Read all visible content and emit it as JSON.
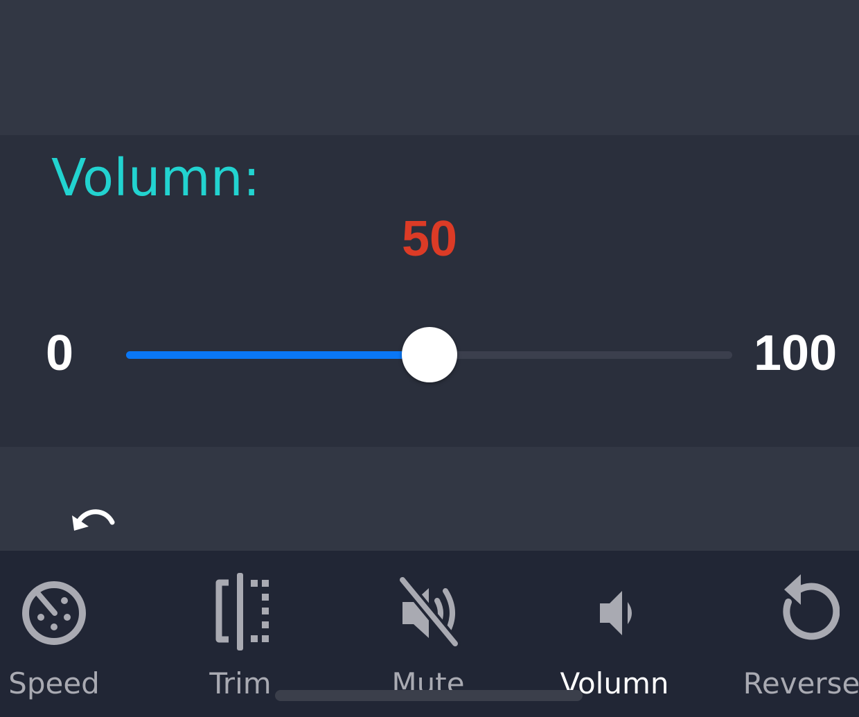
{
  "volume_panel": {
    "title": "Volumn:",
    "value_text": "50",
    "min_label": "0",
    "max_label": "100",
    "slider": {
      "min": 0,
      "max": 100,
      "value": 50
    }
  },
  "undo": {
    "icon": "undo-icon"
  },
  "toolbar": {
    "items": [
      {
        "label": "Speed",
        "icon": "speedometer-icon",
        "active": false
      },
      {
        "label": "Trim",
        "icon": "trim-icon",
        "active": false
      },
      {
        "label": "Mute",
        "icon": "mute-icon",
        "active": false
      },
      {
        "label": "Volumn",
        "icon": "volume-icon",
        "active": true
      },
      {
        "label": "Reverse",
        "icon": "reverse-icon",
        "active": false
      }
    ]
  },
  "colors": {
    "title": "#22d3d0",
    "value": "#dc3b26",
    "slider_fill": "#0a77f5",
    "slider_track": "#3b3f4d",
    "toolbar_bg": "#212635",
    "icon_inactive": "#a9aab2",
    "label_active": "#ffffff"
  }
}
